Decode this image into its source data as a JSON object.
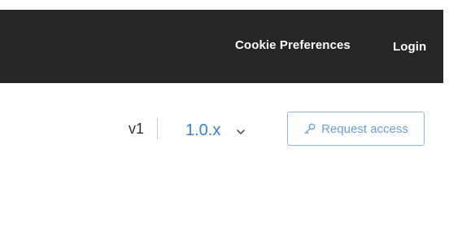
{
  "header": {
    "links": {
      "cookie_preferences": "Cookie Preferences",
      "login": "Login"
    }
  },
  "version_bar": {
    "api_version": "v1",
    "selected_release": "1.0.x",
    "request_access_label": "Request access"
  },
  "icons": {
    "version_dropdown": "chevron-down-icon",
    "request_access": "key-icon"
  },
  "colors": {
    "header_background": "#262626",
    "accent": "#3a7fd6",
    "button_border": "#8fb6ea"
  }
}
